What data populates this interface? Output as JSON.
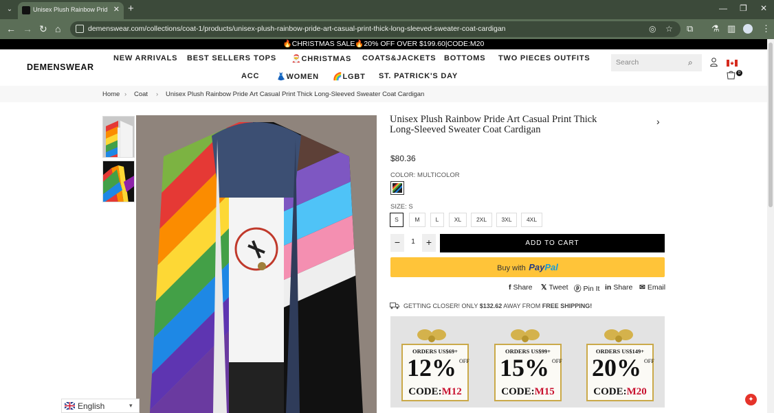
{
  "browser": {
    "tab_title": "Unisex Plush Rainbow Pride Art",
    "url": "demenswear.com/collections/coat-1/products/unisex-plush-rainbow-pride-art-casual-print-thick-long-sleeved-sweater-coat-cardigan"
  },
  "promo_banner": "🔥CHRISTMAS SALE🔥20% OFF OVER $199.60|CODE:M20",
  "header": {
    "logo": "DEMENSWEAR",
    "nav": [
      "NEW ARRIVALS",
      "BEST SELLERS",
      "TOPS",
      "🎅CHRISTMAS",
      "COATS&JACKETS",
      "BOTTOMS",
      "TWO PIECES OUTFITS",
      "ACC",
      "👗WOMEN",
      "🌈LGBT",
      "ST. PATRICK'S DAY"
    ],
    "search_placeholder": "Search",
    "cart_count": "0"
  },
  "breadcrumb": [
    "Home",
    "›",
    "Coat",
    "›",
    "Unisex Plush Rainbow Pride Art Casual Print Thick Long-Sleeved Sweater Coat Cardigan"
  ],
  "product": {
    "title": "Unisex Plush Rainbow Pride Art Casual Print Thick Long-Sleeved Sweater Coat Cardigan",
    "price": "$80.36",
    "color_label": "COLOR: MULTICOLOR",
    "size_label": "SIZE: S",
    "sizes": [
      "S",
      "M",
      "L",
      "XL",
      "2XL",
      "3XL",
      "4XL"
    ],
    "selected_size": "S",
    "quantity": "1",
    "add_to_cart": "ADD TO CART",
    "paypal_buy": "Buy with",
    "paypal_pay": "Pay",
    "paypal_pal": "Pal"
  },
  "share": [
    "Share",
    "Tweet",
    "Pin It",
    "Share",
    "Email"
  ],
  "shipping": {
    "prefix": "GETTING CLOSER! ONLY",
    "amount": "$132.62",
    "middle": "AWAY FROM",
    "suffix": "FREE SHIPPING!"
  },
  "discount_cards": [
    {
      "orders": "ORDERS US$69+",
      "pct": "12%",
      "off": "OFF",
      "code_prefix": "CODE:",
      "code": "M12"
    },
    {
      "orders": "ORDERS US$99+",
      "pct": "15%",
      "off": "OFF",
      "code_prefix": "CODE:",
      "code": "M15"
    },
    {
      "orders": "ORDERS US$149+",
      "pct": "20%",
      "off": "OFF",
      "code_prefix": "CODE:",
      "code": "M20"
    }
  ],
  "language": "English",
  "icons": {
    "search": "search-icon",
    "user": "user-icon",
    "cart": "cart-icon",
    "flag": "canada-flag-icon",
    "truck": "truck-icon",
    "facebook": "facebook-icon",
    "twitter": "twitter-icon",
    "pinterest": "pinterest-icon",
    "linkedin": "linkedin-icon",
    "email": "email-icon"
  },
  "colors": {
    "accent": "#000000",
    "paypal": "#ffc439",
    "promo": "#000000",
    "code_red": "#c8102e"
  }
}
